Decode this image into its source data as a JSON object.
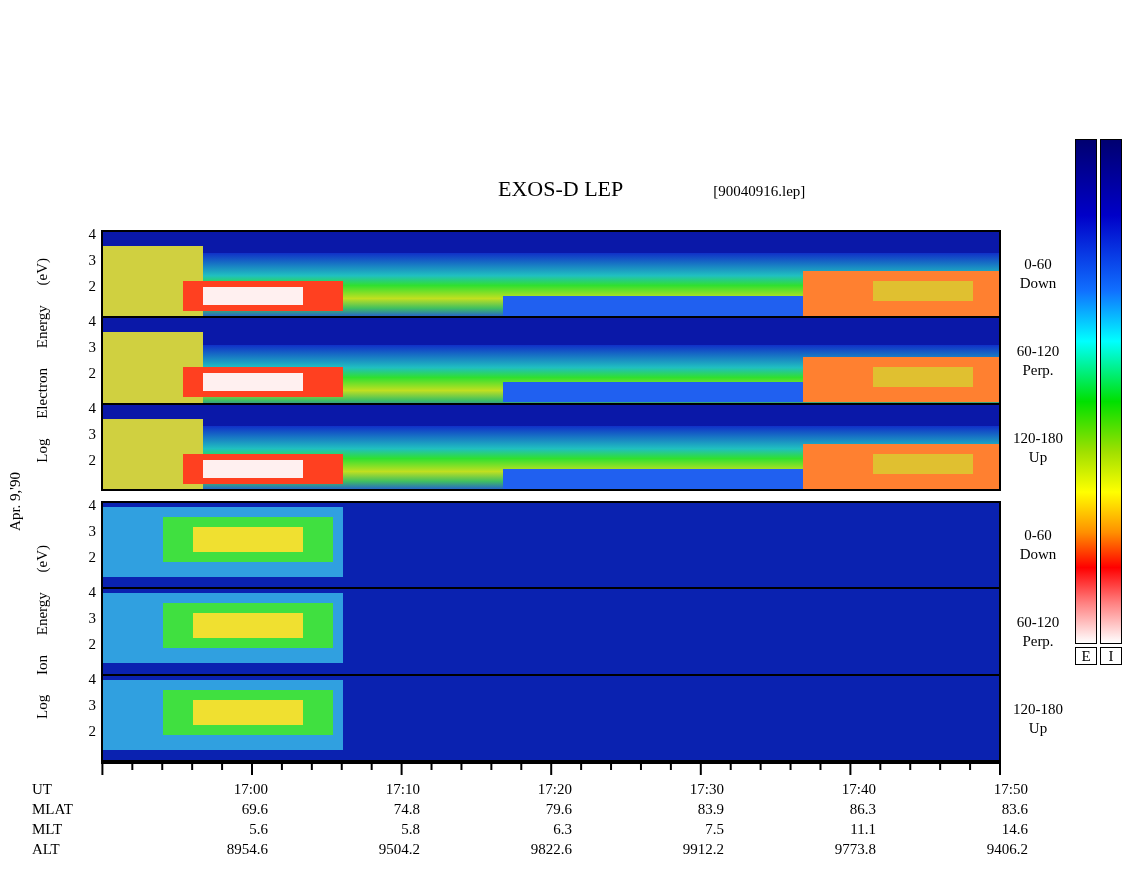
{
  "title": "EXOS-D LEP",
  "file_label": "[90040916.lep]",
  "date_label": "Apr. 9,'90",
  "groups": [
    {
      "kind": "electron",
      "axis_label": "Log Electron Energy (eV)",
      "panels": [
        {
          "range": "0-60",
          "direction": "Down",
          "ticks": [
            "4",
            "3",
            "2"
          ]
        },
        {
          "range": "60-120",
          "direction": "Perp.",
          "ticks": [
            "4",
            "3",
            "2"
          ]
        },
        {
          "range": "120-180",
          "direction": "Up",
          "ticks": [
            "4",
            "3",
            "2"
          ]
        }
      ]
    },
    {
      "kind": "ion",
      "axis_label": "Log Ion Energy (eV)",
      "panels": [
        {
          "range": "0-60",
          "direction": "Down",
          "ticks": [
            "4",
            "3",
            "2"
          ]
        },
        {
          "range": "60-120",
          "direction": "Perp.",
          "ticks": [
            "4",
            "3",
            "2"
          ]
        },
        {
          "range": "120-180",
          "direction": "Up",
          "ticks": [
            "4",
            "3",
            "2"
          ]
        }
      ]
    }
  ],
  "colorbars": [
    {
      "label": "E"
    },
    {
      "label": "I"
    }
  ],
  "time_table": [
    {
      "label": "UT",
      "values": [
        "17:00",
        "17:10",
        "17:20",
        "17:30",
        "17:40",
        "17:50"
      ]
    },
    {
      "label": "MLAT",
      "values": [
        "69.6",
        "74.8",
        "79.6",
        "83.9",
        "86.3",
        "83.6"
      ]
    },
    {
      "label": "MLT",
      "values": [
        "5.6",
        "5.8",
        "6.3",
        "7.5",
        "11.1",
        "14.6"
      ]
    },
    {
      "label": "ALT",
      "values": [
        "8954.6",
        "9504.2",
        "9822.6",
        "9912.2",
        "9773.8",
        "9406.2"
      ]
    }
  ]
}
